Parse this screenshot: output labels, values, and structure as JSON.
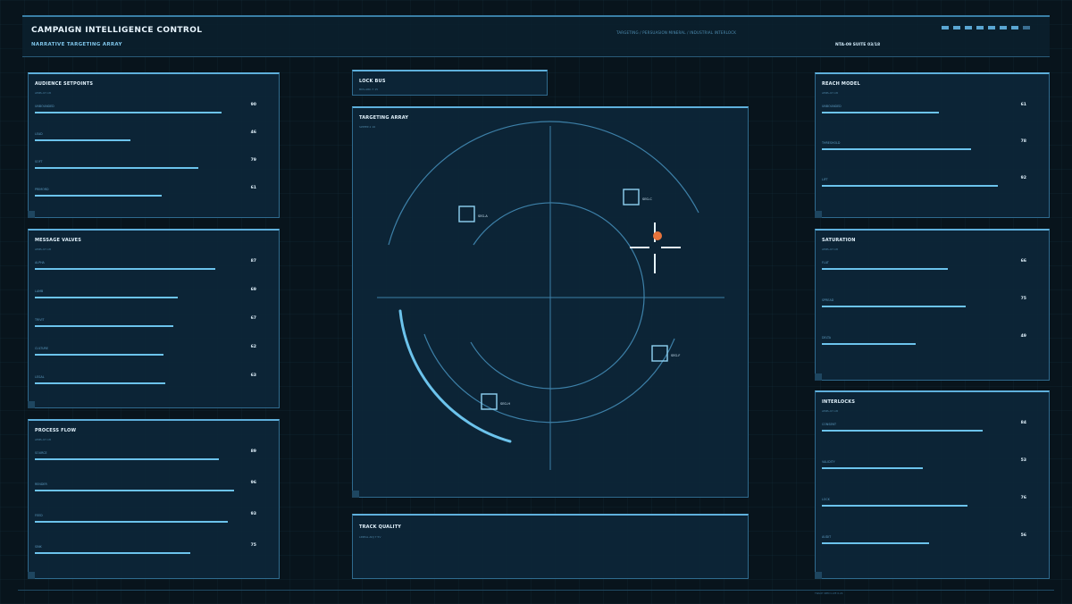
{
  "header": {
    "title": "CAMPAIGN INTELLIGENCE CONTROL",
    "subtitle": "NARRATIVE TARGETING ARRAY",
    "breadcrumb": "TARGETING / PERSUASION MINERAL / INDUSTRIAL INTERLOCK",
    "meta": "NTA-09   SUITE 03/18"
  },
  "left_panels": [
    {
      "title": "AUDIENCE SETPOINTS",
      "subtitle": "AMPL-07-18",
      "rows": [
        {
          "label": "UNBOUNDED",
          "value": 90
        },
        {
          "label": "LEAD",
          "value": 46
        },
        {
          "label": "SOFT",
          "value": 79
        },
        {
          "label": "PRIMORD",
          "value": 61
        }
      ]
    },
    {
      "title": "MESSAGE VALVES",
      "subtitle": "AMPL-07-18",
      "rows": [
        {
          "label": "ALPHA",
          "value": 87
        },
        {
          "label": "LAMB",
          "value": 69
        },
        {
          "label": "TRIVIT",
          "value": 67
        },
        {
          "label": "CULTURE",
          "value": 62
        },
        {
          "label": "LEGAL",
          "value": 63
        }
      ]
    },
    {
      "title": "PROCESS FLOW",
      "subtitle": "AMPL-07-18",
      "rows": [
        {
          "label": "SOURCE",
          "value": 89
        },
        {
          "label": "RENDER",
          "value": 96
        },
        {
          "label": "FEED",
          "value": 93
        },
        {
          "label": "SINK",
          "value": 75
        }
      ]
    }
  ],
  "right_panels": [
    {
      "title": "REACH MODEL",
      "subtitle": "AMPL-07-18",
      "rows": [
        {
          "label": "UNBOUNDED",
          "value": 61
        },
        {
          "label": "THRESHOLD",
          "value": 78
        },
        {
          "label": "LIFT",
          "value": 92
        }
      ]
    },
    {
      "title": "SATURATION",
      "subtitle": "AMPL-07-18",
      "rows": [
        {
          "label": "FLAT",
          "value": 66
        },
        {
          "label": "SPREAD",
          "value": 75
        },
        {
          "label": "DELTA",
          "value": 49
        }
      ]
    },
    {
      "title": "INTERLOCKS",
      "subtitle": "AMPL-07-18",
      "rows": [
        {
          "label": "CONSENT",
          "value": 84
        },
        {
          "label": "VALIDITY",
          "value": 53
        },
        {
          "label": "LOCK",
          "value": 76
        },
        {
          "label": "AUDIT",
          "value": 56
        }
      ]
    }
  ],
  "lock_bus": {
    "title": "LOCK BUS",
    "subtitle": "BUS-ARC-7 15"
  },
  "targeting": {
    "title": "TARGETING ARRAY",
    "subtitle": "SWEEP-1 16",
    "targets": [
      {
        "label": "SEG-A"
      },
      {
        "label": "SEG-C"
      },
      {
        "label": "SEG-F"
      },
      {
        "label": "SEG-H"
      }
    ]
  },
  "track_quality": {
    "title": "TRACK QUALITY",
    "subtitle": "LINEAL ADJ 7 5V"
  },
  "footer": "TRACE SEED   LIVE 0.24",
  "colors": {
    "accent": "#6cc3ec",
    "lock": "#e8743c",
    "panel": "#0d2638"
  }
}
